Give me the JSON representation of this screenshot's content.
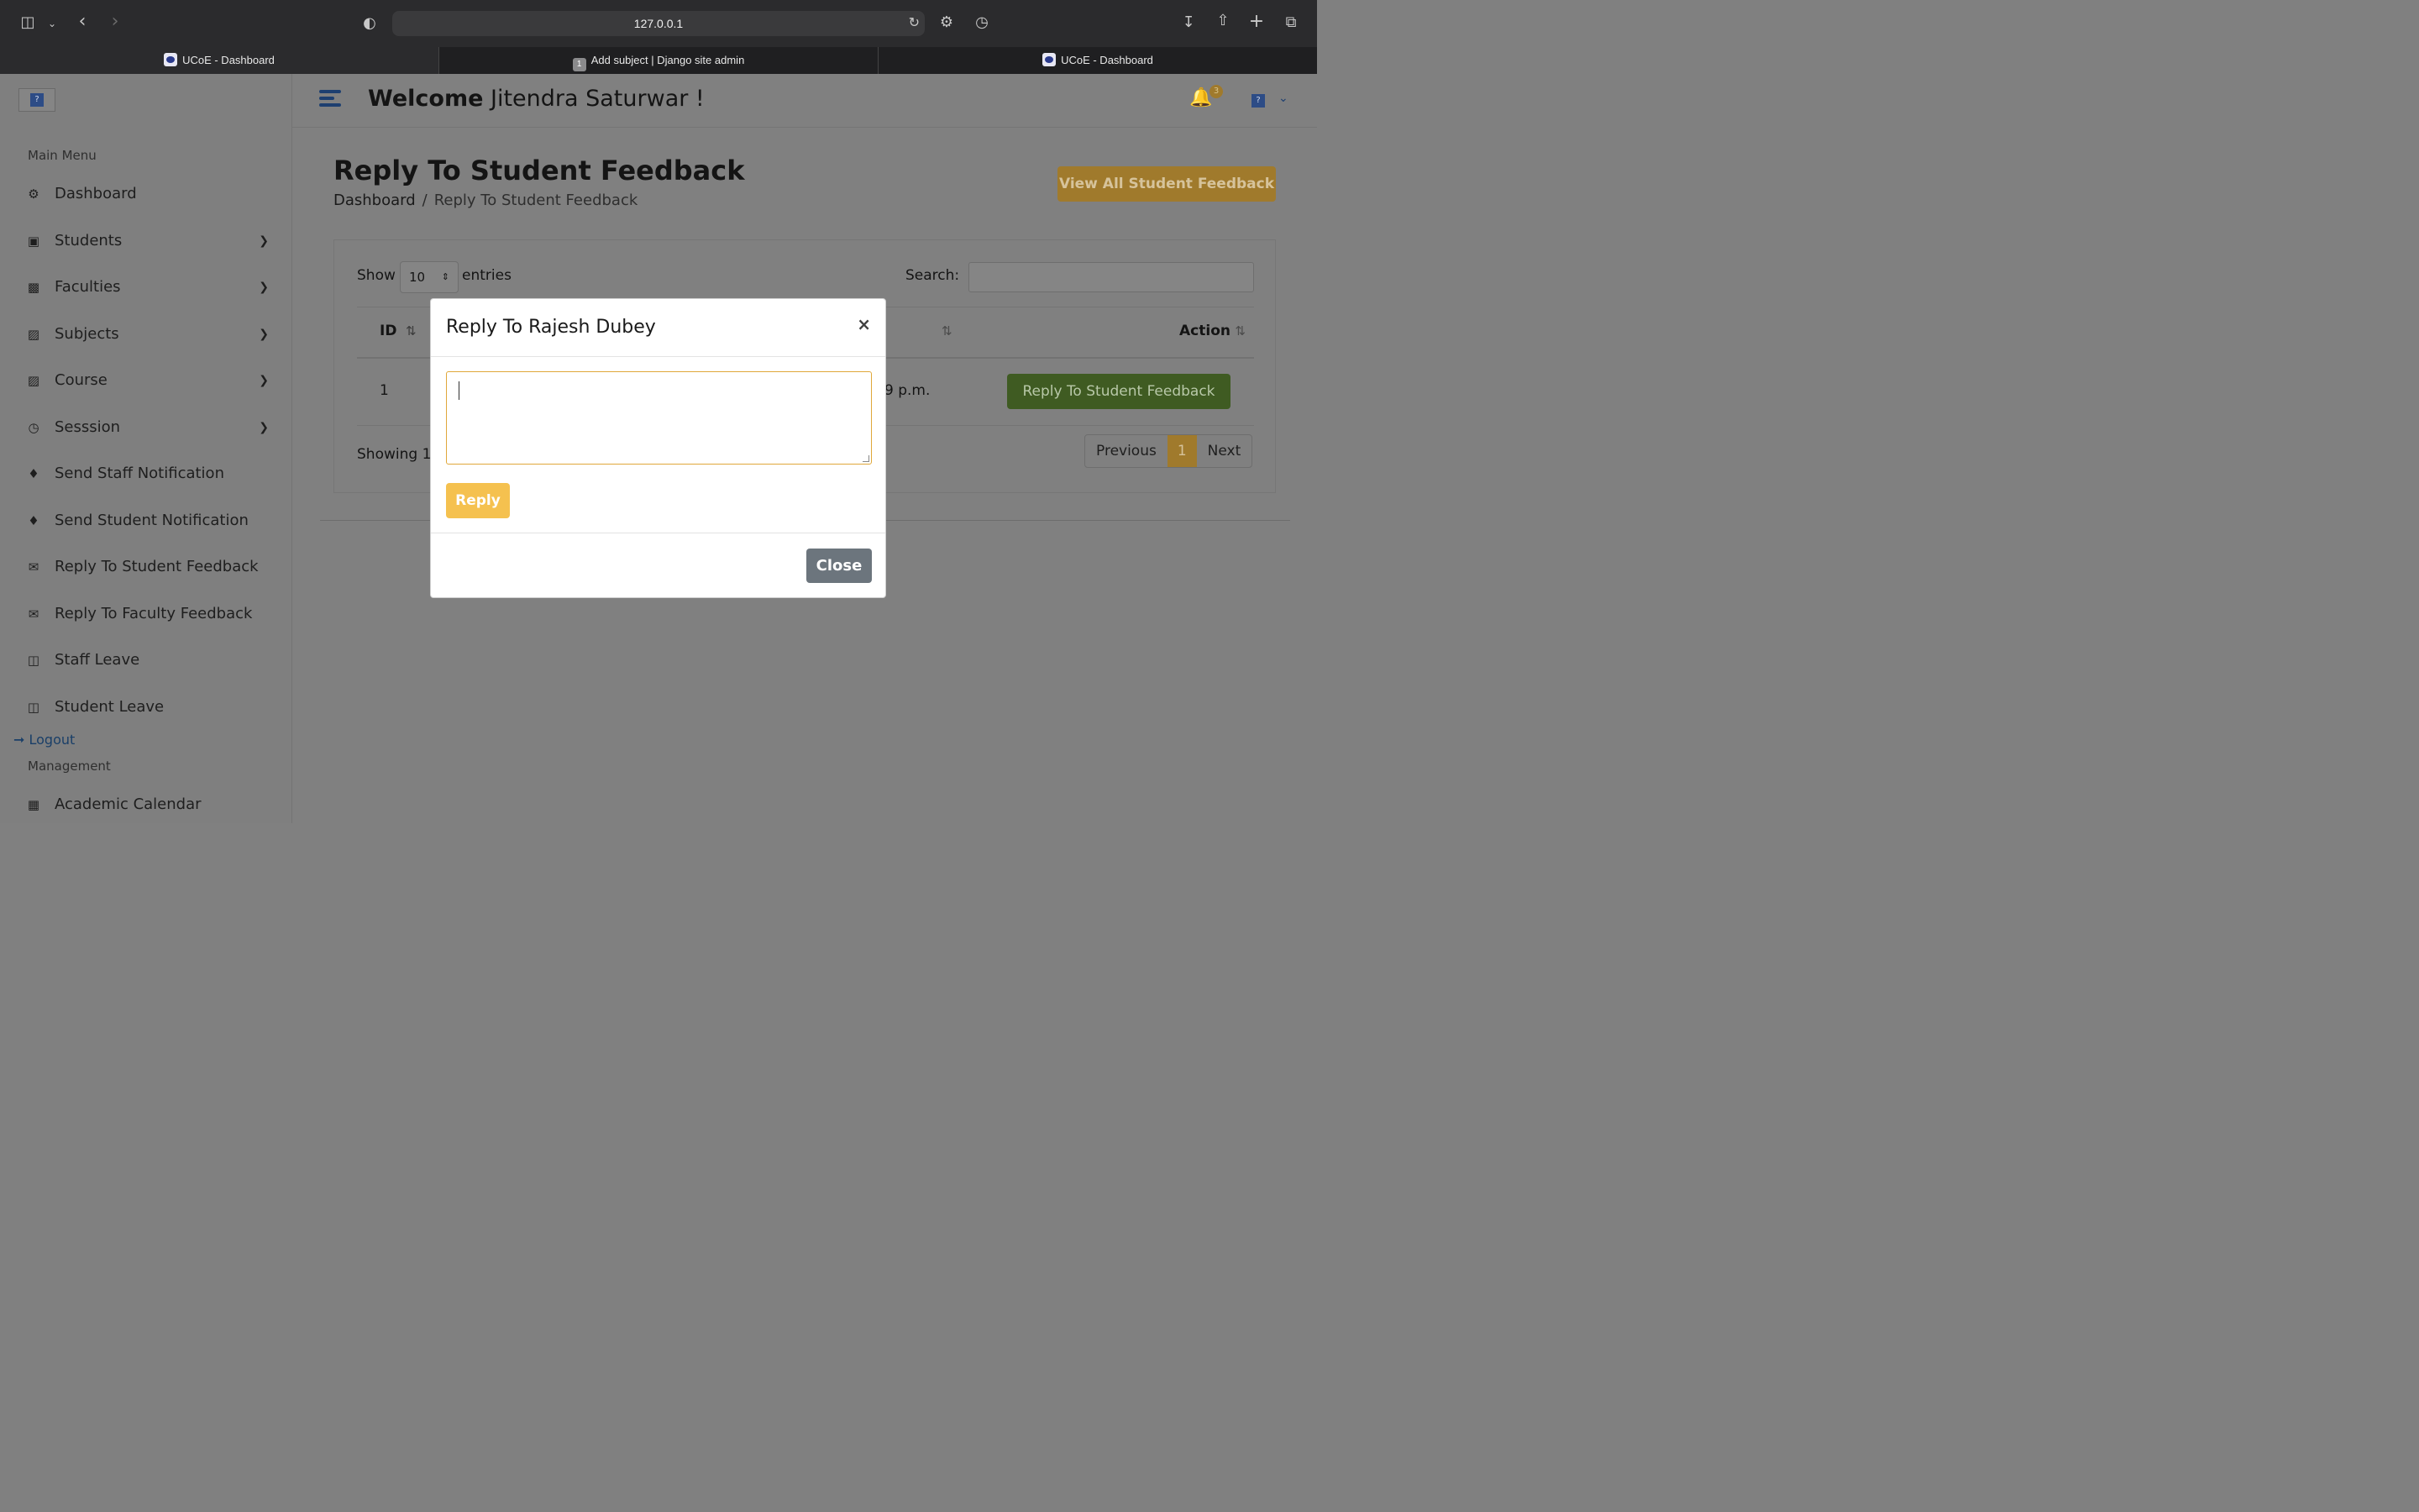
{
  "browser": {
    "url": "127.0.0.1",
    "tabs": [
      {
        "title": "UCoE - Dashboard",
        "active": true
      },
      {
        "title": "Add subject | Django site admin",
        "badge": "1",
        "active": false
      },
      {
        "title": "UCoE - Dashboard",
        "active": false
      }
    ],
    "icons": [
      "sidebar-toggle-icon",
      "chevron-down-icon",
      "back-icon",
      "forward-icon",
      "shield-icon",
      "reload-icon",
      "gear-icon",
      "history-icon",
      "download-icon",
      "share-icon",
      "new-tab-icon",
      "tab-overview-icon"
    ]
  },
  "sidebar": {
    "main_menu_title": "Main Menu",
    "items": [
      {
        "label": "Dashboard",
        "icon": "dashboard-icon",
        "has_submenu": false
      },
      {
        "label": "Students",
        "icon": "student-icon",
        "has_submenu": true
      },
      {
        "label": "Faculties",
        "icon": "faculty-icon",
        "has_submenu": true
      },
      {
        "label": "Subjects",
        "icon": "subjects-icon",
        "has_submenu": true
      },
      {
        "label": "Course",
        "icon": "course-icon",
        "has_submenu": true
      },
      {
        "label": "Sesssion",
        "icon": "clock-icon",
        "has_submenu": true
      },
      {
        "label": "Send Staff Notification",
        "icon": "bell-icon",
        "has_submenu": false
      },
      {
        "label": "Send Student Notification",
        "icon": "bell-icon",
        "has_submenu": false
      },
      {
        "label": "Reply To Student Feedback",
        "icon": "comments-icon",
        "has_submenu": false
      },
      {
        "label": "Reply To Faculty Feedback",
        "icon": "comments-icon",
        "has_submenu": false
      },
      {
        "label": "Staff Leave",
        "icon": "envelope-open-icon",
        "has_submenu": false
      },
      {
        "label": "Student Leave",
        "icon": "envelope-open-icon",
        "has_submenu": false
      }
    ],
    "logout_label": "Logout",
    "management_title": "Management",
    "management_items": [
      {
        "label": "Academic Calendar",
        "icon": "calendar-icon"
      }
    ]
  },
  "header": {
    "welcome_bold": "Welcome",
    "user_name": "Jitendra Saturwar  !",
    "notification_count": "3"
  },
  "page": {
    "title": "Reply To Student Feedback",
    "breadcrumb_home": "Dashboard",
    "breadcrumb_sep": "/",
    "breadcrumb_current": "Reply To Student Feedback",
    "view_all_label": "View All Student Feedback"
  },
  "table": {
    "show_label": "Show",
    "entries_value": "10",
    "entries_label": "entries",
    "search_label": "Search:",
    "search_value": "",
    "col_id": "ID",
    "col_action": "Action",
    "rows": [
      {
        "id": "1",
        "time_fragment": "9 p.m.",
        "action_label": "Reply To Student Feedback"
      }
    ],
    "showing_text": "Showing 1",
    "pagination": {
      "previous": "Previous",
      "current": "1",
      "next": "Next"
    }
  },
  "modal": {
    "title": "Reply To Rajesh Dubey",
    "close_x": "×",
    "textarea_value": "",
    "reply_label": "Reply",
    "close_label": "Close"
  },
  "colors": {
    "accent_orange": "#f5c14f",
    "reply_green": "#3f5b22",
    "close_gray": "#6c757d",
    "brand_blue": "#1d3f70"
  }
}
